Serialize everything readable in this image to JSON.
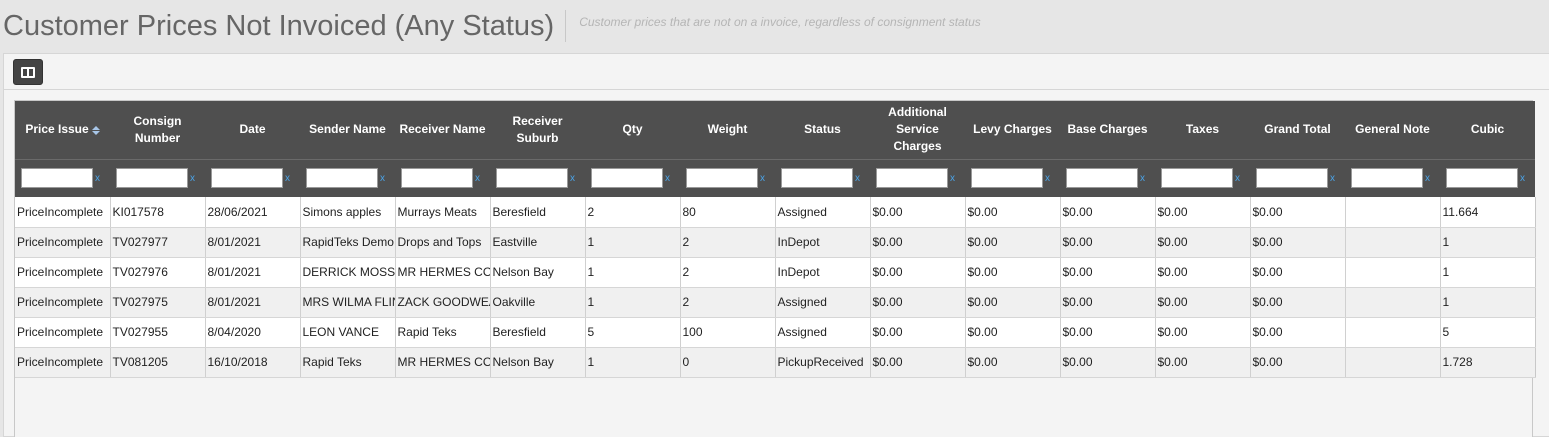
{
  "header": {
    "title": "Customer Prices Not Invoiced (Any Status)",
    "subtitle": "Customer prices that are not on a invoice, regardless of consignment status"
  },
  "toolbar": {
    "columns_icon": "columns-icon"
  },
  "grid": {
    "columns": [
      "Price Issue",
      "Consign Number",
      "Date",
      "Sender Name",
      "Receiver Name",
      "Receiver Suburb",
      "Qty",
      "Weight",
      "Status",
      "Additional Service Charges",
      "Levy Charges",
      "Base Charges",
      "Taxes",
      "Grand Total",
      "General Note",
      "Cubic"
    ],
    "sorted_column": "Price Issue",
    "filter_clear_glyph": "x",
    "rows": [
      [
        "PriceIncomplete",
        "KI017578",
        "28/06/2021",
        "Simons apples",
        "Murrays Meats",
        "Beresfield",
        "2",
        "80",
        "Assigned",
        "$0.00",
        "$0.00",
        "$0.00",
        "$0.00",
        "$0.00",
        "",
        "11.664"
      ],
      [
        "PriceIncomplete",
        "TV027977",
        "8/01/2021",
        "RapidTeks Demo",
        "Drops and Tops",
        "Eastville",
        "1",
        "2",
        "InDepot",
        "$0.00",
        "$0.00",
        "$0.00",
        "$0.00",
        "$0.00",
        "",
        "1"
      ],
      [
        "PriceIncomplete",
        "TV027976",
        "8/01/2021",
        "DERRICK MOSS",
        "MR HERMES CO",
        "Nelson Bay",
        "1",
        "2",
        "InDepot",
        "$0.00",
        "$0.00",
        "$0.00",
        "$0.00",
        "$0.00",
        "",
        "1"
      ],
      [
        "PriceIncomplete",
        "TV027975",
        "8/01/2021",
        "MRS WILMA FLIN",
        "ZACK GOODWEA",
        "Oakville",
        "1",
        "2",
        "Assigned",
        "$0.00",
        "$0.00",
        "$0.00",
        "$0.00",
        "$0.00",
        "",
        "1"
      ],
      [
        "PriceIncomplete",
        "TV027955",
        "8/04/2020",
        "LEON VANCE",
        "Rapid Teks",
        "Beresfield",
        "5",
        "100",
        "Assigned",
        "$0.00",
        "$0.00",
        "$0.00",
        "$0.00",
        "$0.00",
        "",
        "5"
      ],
      [
        "PriceIncomplete",
        "TV081205",
        "16/10/2018",
        "Rapid Teks",
        "MR HERMES CO",
        "Nelson Bay",
        "1",
        "0",
        "PickupReceived",
        "$0.00",
        "$0.00",
        "$0.00",
        "$0.00",
        "$0.00",
        "",
        "1.728"
      ]
    ]
  }
}
